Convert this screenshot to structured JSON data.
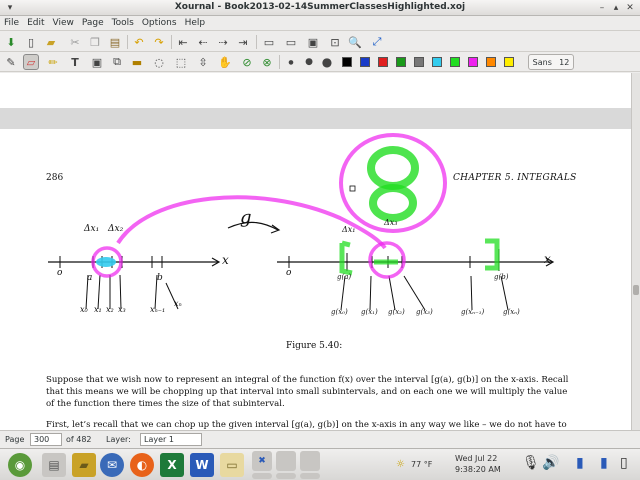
{
  "window": {
    "title": "Xournal - Book2013-02-14SummerClassesHighlighted.xoj"
  },
  "menu": [
    "File",
    "Edit",
    "View",
    "Page",
    "Tools",
    "Options",
    "Help"
  ],
  "toolbar_font": {
    "name": "Sans",
    "size": "12"
  },
  "colors": [
    "#000000",
    "#1a3cc8",
    "#e02020",
    "#1a9a1a",
    "#777777",
    "#33ccee",
    "#22dd22",
    "#ee22ee",
    "#ff8800",
    "#ffee00",
    "#ffffff"
  ],
  "page": {
    "number": "286",
    "chapter": "CHAPTER 5.  INTEGRALS",
    "figure_caption": "Figure 5.40:",
    "para1": [
      "Suppose that we wish now to represent an integral of the function f(x) over the interval [g(a), g(b)] on the x-axis. Recall",
      "that this means we will be chopping up that interval into small subintervals, and on each one we will multiply the value",
      "of the function there times the size of that subinterval."
    ],
    "para2": "First, let’s recall that we can chop up the given interval [g(a), g(b)] on the x-axis in any way we like – we do not have to"
  },
  "handwriting": {
    "left_labels": [
      "Δx₁",
      "Δx₂",
      "x",
      "o",
      "a",
      "b",
      "x₀",
      "x₁",
      "x₂",
      "x₃",
      "xₙ₋₁",
      "xₙ"
    ],
    "g_label": "g",
    "right_labels": [
      "Δx₁",
      "Δx₃",
      "x",
      "o",
      "g(a)",
      "g(b)",
      "g(x₀)",
      "g(x₁)",
      "g(x₂)",
      "g(x₃)",
      "g(xₙ₋₁)",
      "g(xₙ)"
    ]
  },
  "status": {
    "page_label": "Page",
    "page_value": "300",
    "of_label": "of 482",
    "layer_label": "Layer:",
    "layer_value": "Layer 1"
  },
  "tray": {
    "temp": "77 °F",
    "date": "Wed Jul 22",
    "time": "9:38:20 AM"
  }
}
